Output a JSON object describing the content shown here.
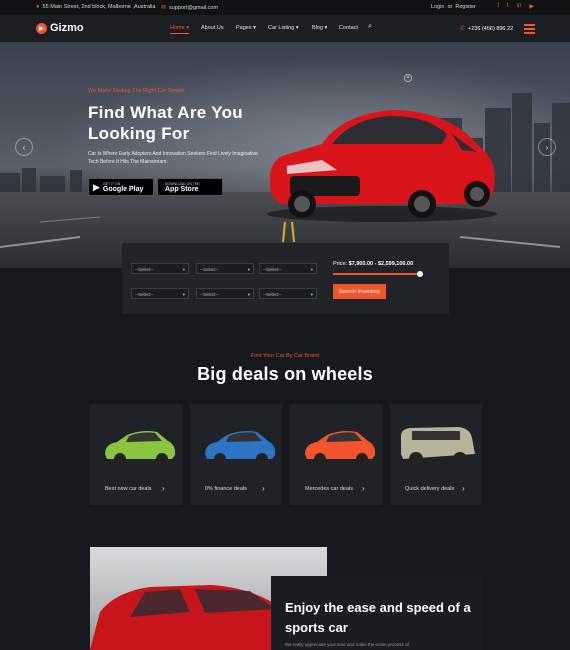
{
  "topbar": {
    "address": "55 Main Street, 2nd block, Malborne ,Australia",
    "email": "support@gmail.com",
    "auth_login": "Login",
    "auth_sep": "or",
    "auth_register": "Register",
    "social_icons": [
      "facebook-icon",
      "twitter-icon",
      "linkedin-icon",
      "youtube-icon"
    ]
  },
  "header": {
    "logo": "Gizmo",
    "nav": [
      "Home",
      "About Us",
      "Pages",
      "Car Listing",
      "Blog",
      "Contact"
    ],
    "phone": "+236 (456) 896 22"
  },
  "hero": {
    "tag": "We Make Finding The Right Car Simple",
    "title": "Find What Are You Looking For",
    "desc": "Car Is Where Early Adopters And Innovation Seekers Find Lively Imaginative Tech Before It Hits The Mainstream.",
    "google_small": "GET IT ON",
    "google": "Google Play",
    "apple_small": "DOWNLOAD ON THE",
    "apple": "App Store"
  },
  "search": {
    "select_placeholder": "--Select--",
    "price_label": "Price:",
    "price_range": "$7,900.00 - $2,599,100.00",
    "button": "Search Inventory"
  },
  "brands": {
    "tag": "Find Your Car By Car Brand",
    "title": "Big deals on wheels",
    "cards": [
      {
        "label": "Best new car deals",
        "color": "#8bc53f"
      },
      {
        "label": "0% finance deals",
        "color": "#2d74c4"
      },
      {
        "label": "Mercedes car deals",
        "color": "#f2552c"
      },
      {
        "label": "Quick delivery deals",
        "color": "#b7b49b"
      }
    ]
  },
  "promo": {
    "title": "Enjoy the ease and speed of a sports car",
    "text": "We really appreciate your time and make the entire process of"
  },
  "colors": {
    "accent": "#f2552c",
    "bg": "#16191d"
  }
}
